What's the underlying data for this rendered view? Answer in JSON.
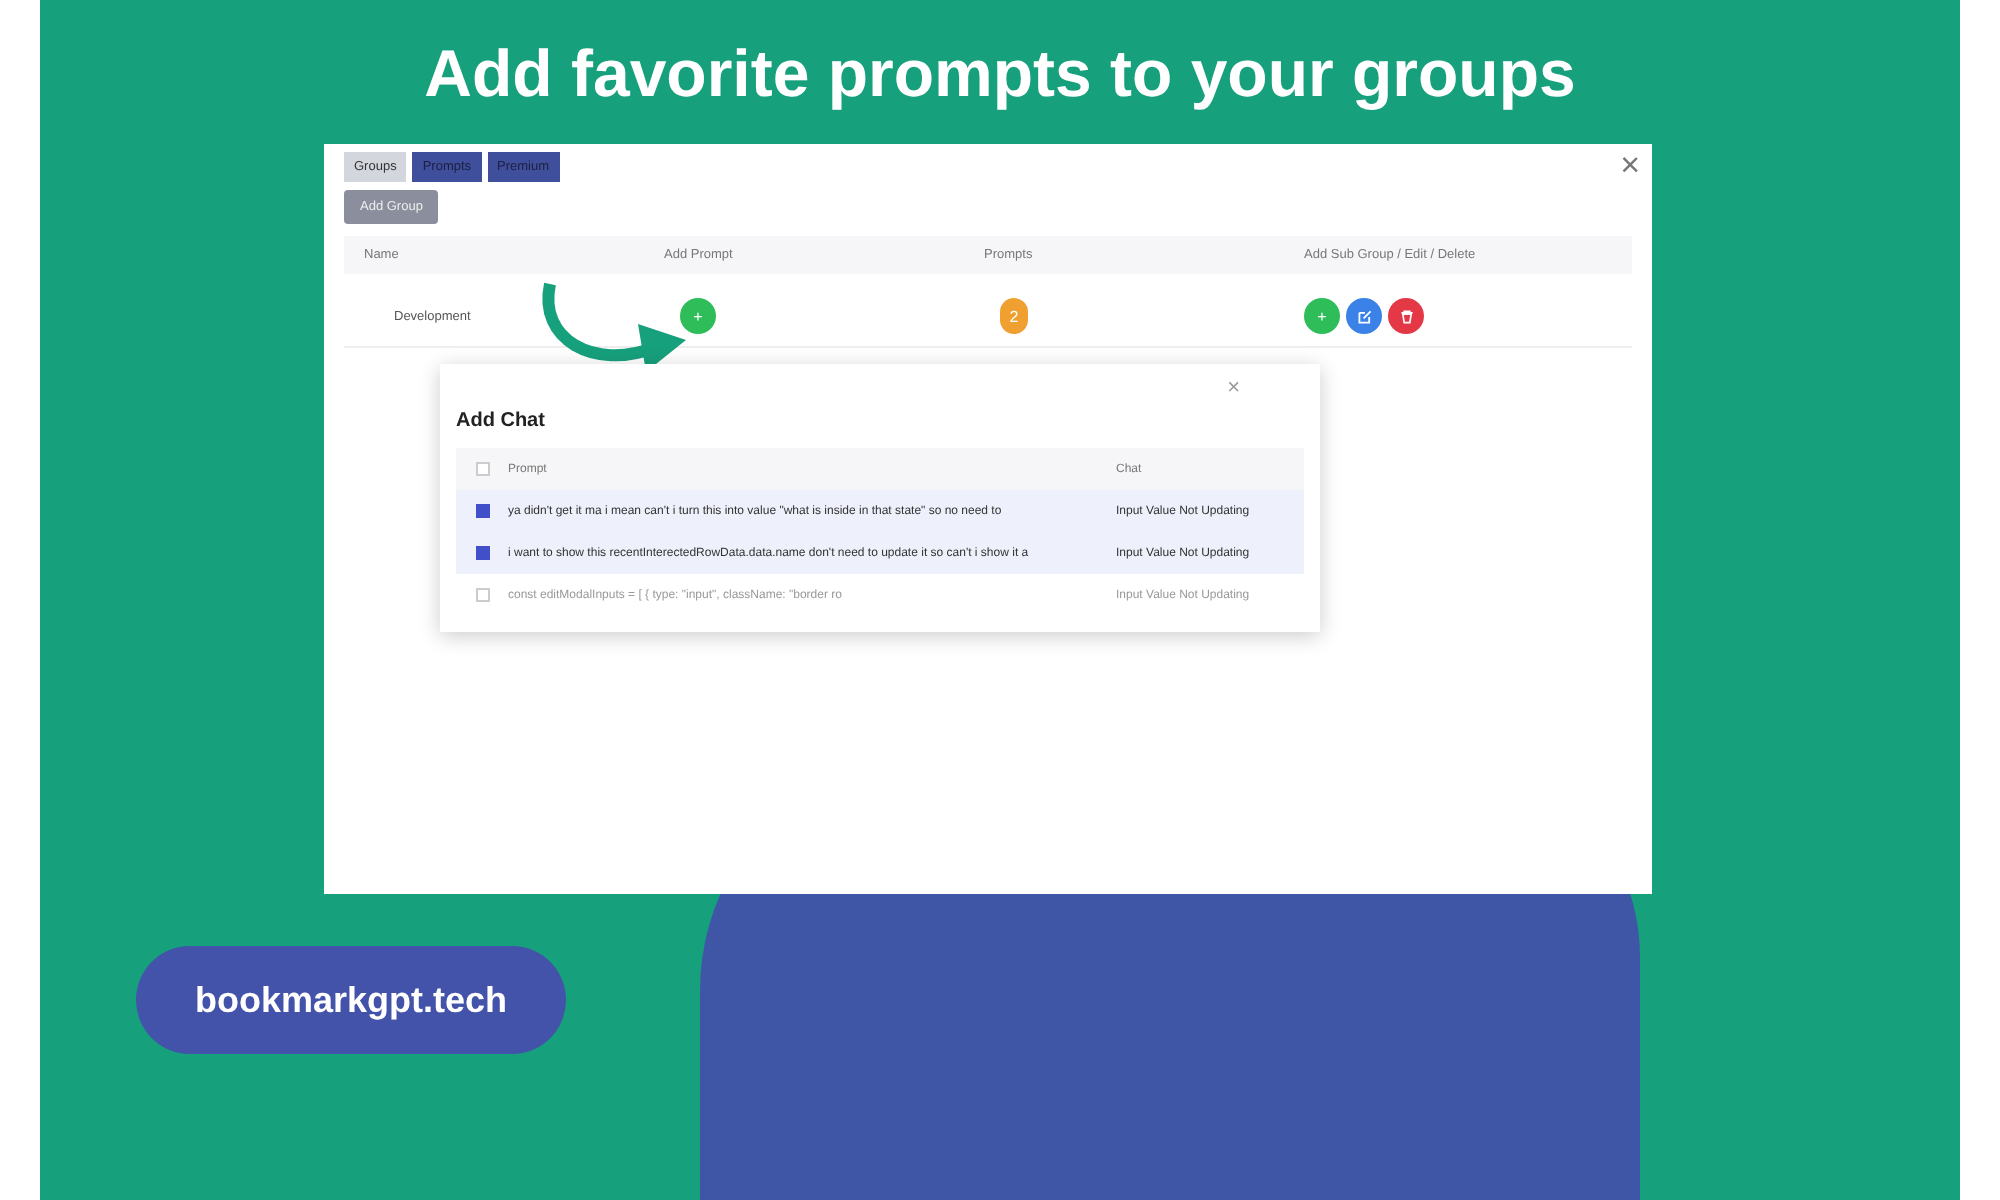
{
  "headline": "Add favorite prompts to your groups",
  "app": {
    "tabs": [
      {
        "label": "Groups",
        "selected": true
      },
      {
        "label": "Prompts",
        "selected": false
      },
      {
        "label": "Premium",
        "selected": false
      }
    ],
    "close": "×",
    "add_group": "Add Group",
    "table": {
      "columns": [
        "Name",
        "Add Prompt",
        "Prompts",
        "Add Sub Group / Edit / Delete"
      ],
      "rows": [
        {
          "name": "Development",
          "add": "+",
          "prompts": "2",
          "sub": "+"
        }
      ]
    },
    "modal": {
      "title": "Add Chat",
      "close": "×",
      "select_all_checked": false,
      "columns": [
        "Prompt",
        "Chat"
      ],
      "rows": [
        {
          "checked": true,
          "prompt": "ya didn't get it ma i mean can't i turn this into value \"what is inside in that state\" so no need to",
          "chat": "Input Value Not Updating"
        },
        {
          "checked": true,
          "prompt": "i want to show this recentInterectedRowData.data.name don't need to update it so can't i show it a",
          "chat": "Input Value Not Updating"
        },
        {
          "checked": false,
          "prompt": "const editModalInputs = [ { type: \"input\", className: \"border ro",
          "chat": "Input Value Not Updating"
        }
      ]
    }
  },
  "site": "bookmarkgpt.tech"
}
